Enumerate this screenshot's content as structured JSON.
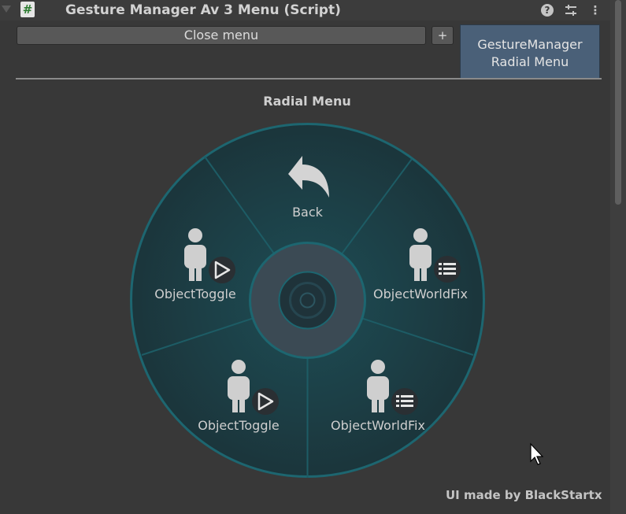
{
  "header": {
    "title": "Gesture Manager Av 3 Menu (Script)",
    "script_glyph": "#"
  },
  "toolbar": {
    "close_label": "Close menu",
    "add_label": "+"
  },
  "tab": {
    "line1": "GestureManager",
    "line2": "Radial Menu"
  },
  "section_title": "Radial Menu",
  "radial": {
    "items": [
      {
        "label": "Back",
        "icon": "back-arrow-icon"
      },
      {
        "label": "ObjectWorldFix",
        "icon": "avatar-sub-menu-icon"
      },
      {
        "label": "ObjectWorldFix",
        "icon": "avatar-sub-menu-icon"
      },
      {
        "label": "ObjectToggle",
        "icon": "avatar-toggle-icon"
      },
      {
        "label": "ObjectToggle",
        "icon": "avatar-toggle-icon"
      }
    ]
  },
  "footer": {
    "credit": "UI made by BlackStartx"
  },
  "colors": {
    "ring": "#1d6670",
    "tab": "#4a6078",
    "background": "#383838"
  }
}
